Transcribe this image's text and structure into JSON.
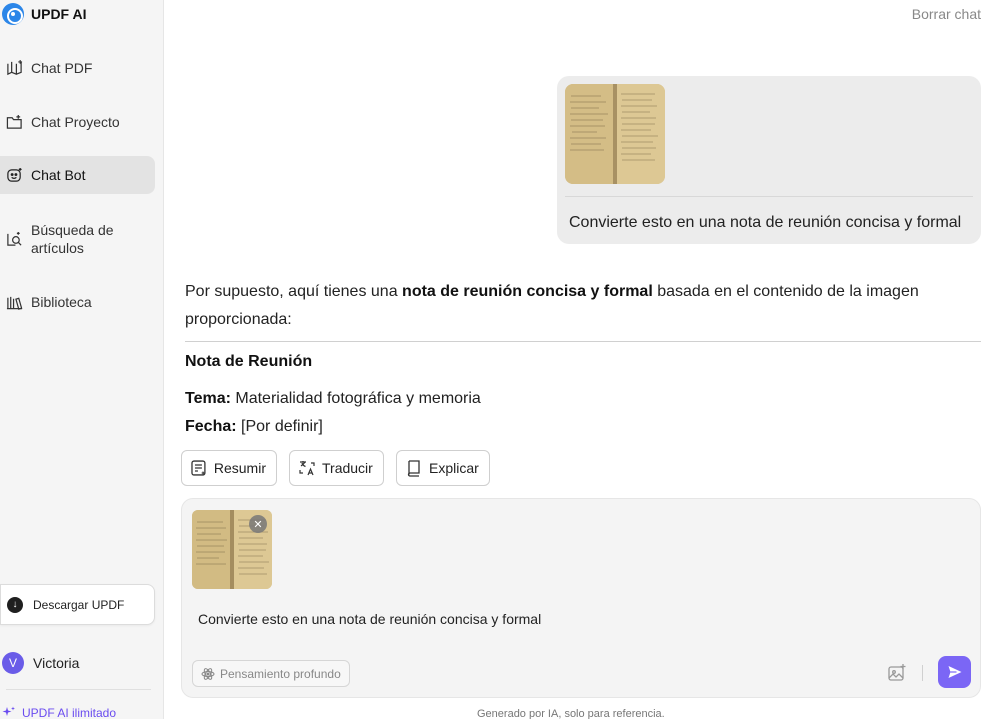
{
  "sidebar": {
    "brand": "UPDF AI",
    "items": [
      {
        "label": "Chat PDF"
      },
      {
        "label": "Chat Proyecto"
      },
      {
        "label": "Chat Bot"
      },
      {
        "label_line1": "Búsqueda de",
        "label_line2": "artículos"
      },
      {
        "label": "Biblioteca"
      }
    ],
    "download": "Descargar UPDF",
    "user": {
      "initial": "V",
      "name": "Victoria"
    },
    "unlimited": "UPDF AI ilimitado"
  },
  "header": {
    "clear_chat": "Borrar chat"
  },
  "user_message": {
    "text": "Convierte esto en una nota de reunión concisa y formal"
  },
  "reply": {
    "intro_a": "Por supuesto, aquí tienes una ",
    "intro_bold": "nota de reunión concisa y formal",
    "intro_b": " basada en el contenido de la imagen proporcionada:",
    "note_title": "Nota de Reunión",
    "tema_label": "Tema:",
    "tema_value": " Materialidad fotográfica y memoria",
    "fecha_label": "Fecha:",
    "fecha_value": " [Por definir]"
  },
  "actions": {
    "summarize": "Resumir",
    "translate": "Traducir",
    "explain": "Explicar"
  },
  "composer": {
    "text": "Convierte esto en una nota de reunión concisa y formal",
    "deep_think": "Pensamiento profundo"
  },
  "footer": "Generado por IA, solo para referencia.",
  "colors": {
    "accent": "#7b66f5",
    "active_bg": "#e3e3e3"
  }
}
